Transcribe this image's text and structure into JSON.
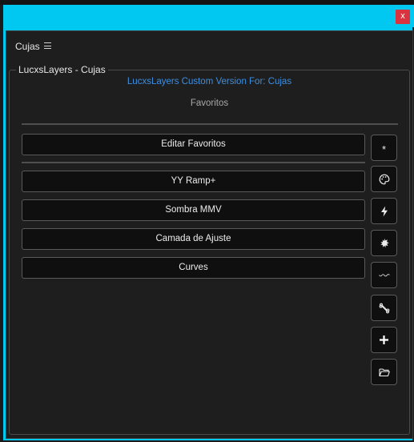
{
  "window": {
    "close_label": "x"
  },
  "panel": {
    "title": "Cujas",
    "group_title": "LucxsLayers - Cujas",
    "custom_version": "LucxsLayers Custom Version For: Cujas",
    "favorites_heading": "Favoritos",
    "edit_favorites_label": "Editar Favoritos",
    "favorites": [
      {
        "label": "YY Ramp+"
      },
      {
        "label": "Sombra MMV"
      },
      {
        "label": "Camada de Ajuste"
      },
      {
        "label": "Curves"
      }
    ]
  },
  "side_buttons": [
    {
      "icon": "star-icon",
      "glyph": "*"
    },
    {
      "icon": "palette-icon"
    },
    {
      "icon": "lightning-icon"
    },
    {
      "icon": "burst-icon"
    },
    {
      "icon": "wave-icon"
    },
    {
      "icon": "bone-icon"
    },
    {
      "icon": "plus-icon"
    },
    {
      "icon": "folder-open-icon"
    }
  ],
  "colors": {
    "accent": "#00c8f0",
    "link_blue": "#3d8fe0",
    "close_red": "#d9333f",
    "panel_bg": "#1e1e1e",
    "button_bg": "#0f0f0f"
  }
}
